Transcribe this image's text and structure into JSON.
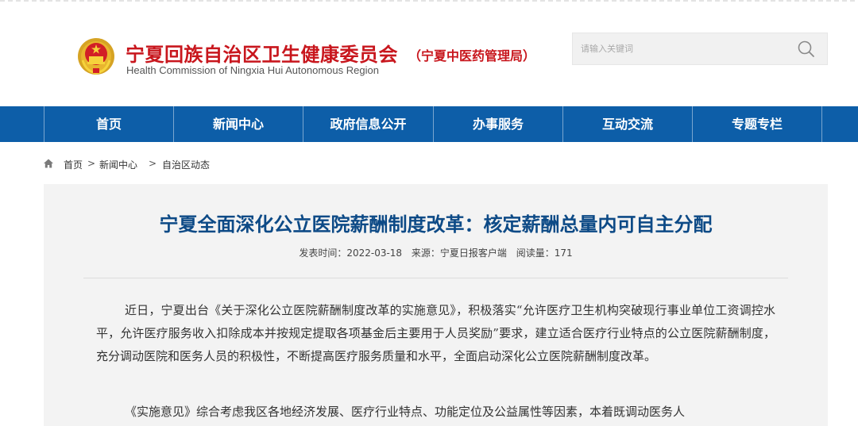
{
  "header": {
    "site_title": "宁夏回族自治区卫生健康委员会",
    "site_subtitle": "（宁夏中医药管理局）",
    "site_english": "Health Commission of Ningxia Hui Autonomous Region",
    "emblem_icon": "national-emblem-icon"
  },
  "search": {
    "placeholder": "请输入关键词",
    "button_icon": "search-icon"
  },
  "nav": {
    "items": [
      {
        "label": "首页"
      },
      {
        "label": "新闻中心"
      },
      {
        "label": "政府信息公开"
      },
      {
        "label": "办事服务"
      },
      {
        "label": "互动交流"
      },
      {
        "label": "专题专栏"
      }
    ]
  },
  "breadcrumb": {
    "home_icon": "home-icon",
    "items": [
      "首页",
      "新闻中心",
      "自治区动态"
    ],
    "separator": ">"
  },
  "article": {
    "title": "宁夏全面深化公立医院薪酬制度改革：核定薪酬总量内可自主分配",
    "meta": {
      "publish_time": "发表时间：2022-03-18",
      "source": "来源：宁夏日报客户端",
      "views": "阅读量：171"
    },
    "paragraphs": [
      "近日，宁夏出台《关于深化公立医院薪酬制度改革的实施意见》，积极落实“允许医疗卫生机构突破现行事业单位工资调控水平，允许医疗服务收入扣除成本并按规定提取各项基金后主要用于人员奖励”要求，建立适合医疗行业特点的公立医院薪酬制度，充分调动医院和医务人员的积极性，不断提高医疗服务质量和水平，全面启动深化公立医院薪酬制度改革。",
      "《实施意见》综合考虑我区各地经济发展、医疗行业特点、功能定位及公益属性等因素，本着既调动医务人"
    ]
  },
  "colors": {
    "brand_red": "#c8161d",
    "nav_blue": "#0d5ea8",
    "title_blue": "#0d4a86",
    "article_bg": "#f3f3f3"
  }
}
